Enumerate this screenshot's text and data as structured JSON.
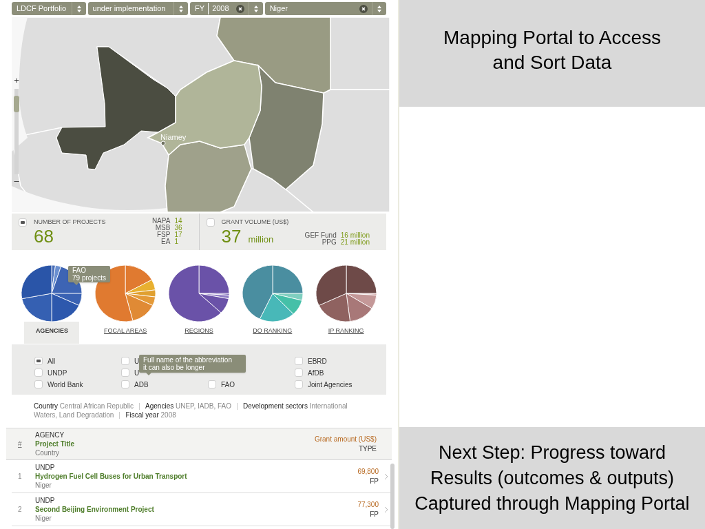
{
  "filters": [
    {
      "label": "LDCF Portfolio",
      "clearable": false
    },
    {
      "label": "under implementation",
      "clearable": false
    },
    {
      "prefix": "FY",
      "label": "2008",
      "clearable": true
    },
    {
      "label": "Niger",
      "clearable": true
    }
  ],
  "map": {
    "city": "Niamey",
    "zoom_in": "+",
    "zoom_out": "–",
    "zoom": {
      "level": 0.9
    }
  },
  "stats": [
    {
      "label": "NUMBER OF PROJECTS",
      "selected": true,
      "value": "68",
      "breakdown": [
        {
          "label": "NAPA",
          "value": "14"
        },
        {
          "label": "MSB",
          "value": "36"
        },
        {
          "label": "FSP",
          "value": "17"
        },
        {
          "label": "EA",
          "value": "1"
        }
      ]
    },
    {
      "label": "GRANT VOLUME (US$)",
      "selected": false,
      "value": "37",
      "unit": "million",
      "breakdown": [
        {
          "label": "GEF Fund",
          "value": "16 million"
        },
        {
          "label": "PPG",
          "value": "21 million"
        }
      ]
    }
  ],
  "charts": [
    {
      "label": "AGENCIES",
      "selected": true
    },
    {
      "label": "FOCAL AREAS",
      "selected": false
    },
    {
      "label": "REGIONS",
      "selected": false
    },
    {
      "label": "DO RANKING",
      "selected": false
    },
    {
      "label": "IP RANKING",
      "selected": false
    }
  ],
  "chart_tooltip": {
    "title": "FAO",
    "text": "79 projects"
  },
  "agency_filter": {
    "columns": [
      [
        {
          "label": "All",
          "checked": true
        },
        {
          "label": "UNDP",
          "checked": false
        },
        {
          "label": "World Bank",
          "checked": false
        }
      ],
      [
        {
          "label": "U",
          "checked": false
        },
        {
          "label": "U",
          "checked": false
        },
        {
          "label": "ADB",
          "checked": false
        }
      ],
      [
        {
          "label": "FAO",
          "checked": false
        }
      ],
      [
        {
          "label": "EBRD",
          "checked": false
        },
        {
          "label": "AfDB",
          "checked": false
        },
        {
          "label": "Joint Agencies",
          "checked": false
        }
      ]
    ],
    "tooltip": "Full name of the abbreviation\nit can also be longer"
  },
  "summary": [
    {
      "key": "Country",
      "value": "Central African Republic"
    },
    {
      "key": "Agencies",
      "value": "UNEP, IADB, FAO"
    },
    {
      "key": "Development sectors",
      "value": "International Waters, Land Degradation"
    },
    {
      "key": "Fiscal year",
      "value": "2008"
    }
  ],
  "table": {
    "header": {
      "number": "#",
      "agency": "AGENCY",
      "title": "Project Title",
      "country": "Country",
      "amount": "Grant amount (US$)",
      "type": "TYPE"
    },
    "rows": [
      {
        "number": "1",
        "agency": "UNDP",
        "title": "Hydrogen Fuel Cell Buses for Urban Transport",
        "country": "Niger",
        "amount": "69,800",
        "type": "FP"
      },
      {
        "number": "2",
        "agency": "UNDP",
        "title": "Second Beijing Environment Project",
        "country": "Niger",
        "amount": "77,300",
        "type": "FP"
      }
    ]
  },
  "slide": {
    "heading": "Mapping Portal to Access and Sort Data",
    "next_step": "Next Step: Progress toward Results (outcomes & outputs) Captured through Mapping Portal"
  }
}
